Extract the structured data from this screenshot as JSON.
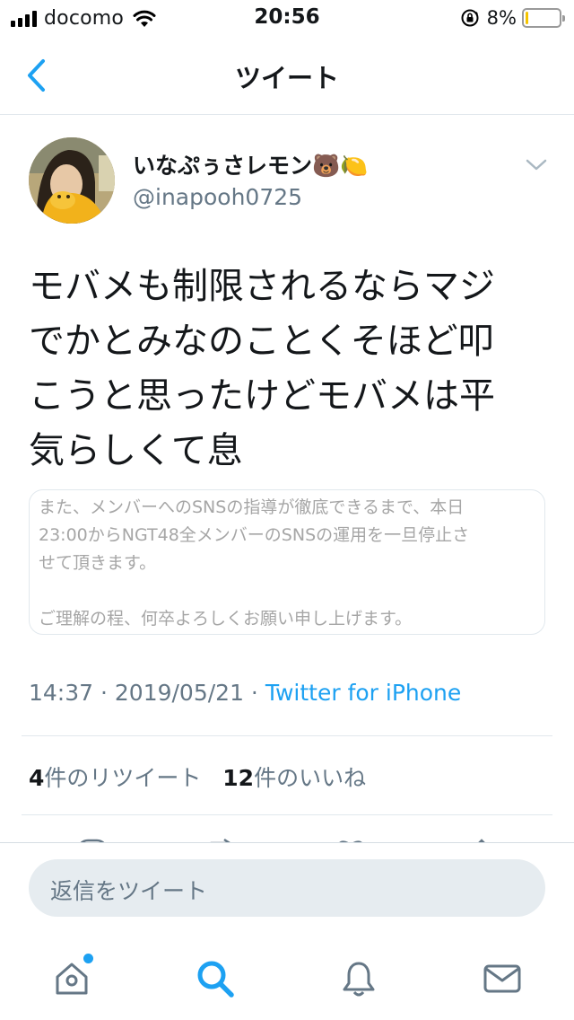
{
  "status_bar": {
    "carrier": "docomo",
    "time": "20:56",
    "battery_percent": "8%",
    "battery_level": 0.08,
    "icons": [
      "signal-icon",
      "wifi-icon",
      "orientation-lock-icon",
      "battery-icon"
    ]
  },
  "nav": {
    "title": "ツイート",
    "back_icon": "chevron-left-icon"
  },
  "tweet": {
    "display_name": "いなぷぅさレモン🐻🍋",
    "username": "@inapooh0725",
    "text": "モバメも制限されるならマジ\nでかとみなのことくそほど叩\nこうと思ったけどモバメは平\n気らしくて息",
    "image_text": "また、メンバーへのSNSの指導が徹底できるまで、本日\n23:00からNGT48全メンバーのSNSの運用を一旦停止さ\nせて頂きます。\n\nご理解の程、何卒よろしくお願い申し上げます。",
    "time": "14:37",
    "separator": " · ",
    "date": "2019/05/21",
    "source": "Twitter for iPhone",
    "retweets_count": "4",
    "retweets_label": "件のリツイート",
    "likes_count": "12",
    "likes_label": "件のいいね"
  },
  "reply": {
    "placeholder": "返信をツイート"
  },
  "tabs": [
    {
      "name": "home",
      "icon": "home-icon",
      "has_notification_dot": true
    },
    {
      "name": "search",
      "icon": "search-icon",
      "active": true
    },
    {
      "name": "notifications",
      "icon": "bell-icon"
    },
    {
      "name": "messages",
      "icon": "mail-icon"
    }
  ],
  "colors": {
    "accent": "#1da1f2",
    "text": "#14171a",
    "secondary": "#657786",
    "divider": "#e1e8ed",
    "battery": "#f5c400"
  }
}
